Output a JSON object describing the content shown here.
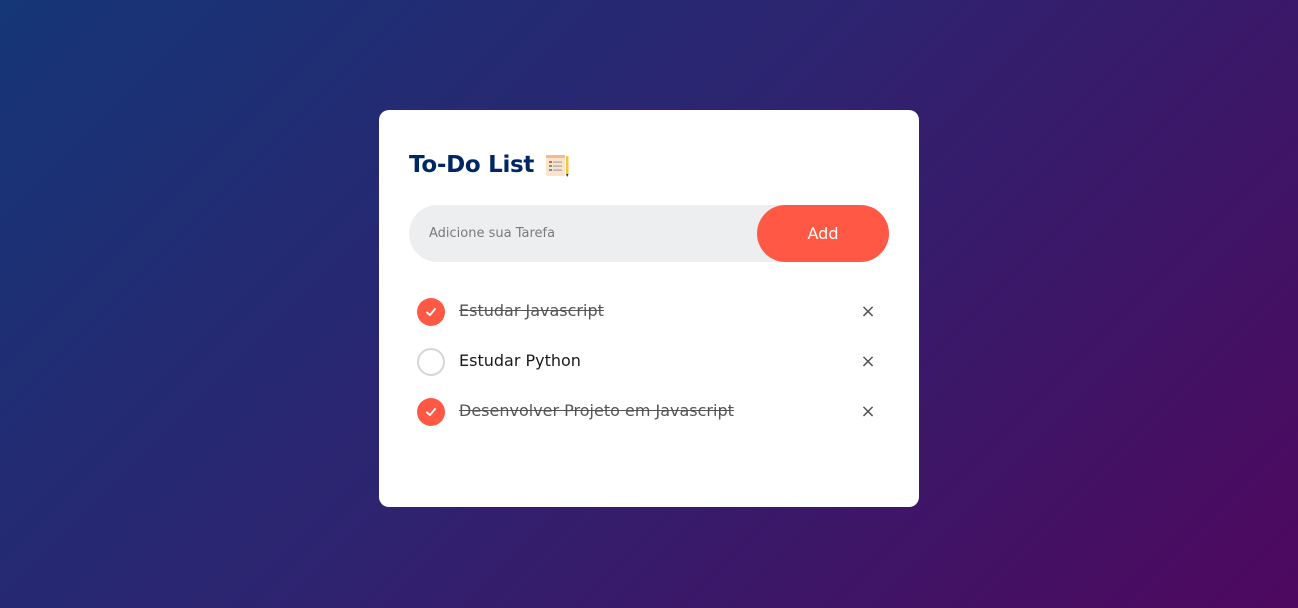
{
  "card": {
    "title": "To-Do List",
    "title_icon": "checklist-notepad-icon"
  },
  "input": {
    "placeholder": "Adicione sua Tarefa",
    "value": ""
  },
  "add_button": {
    "label": "Add"
  },
  "tasks": [
    {
      "label": "Estudar Javascript",
      "done": true
    },
    {
      "label": "Estudar Python",
      "done": false
    },
    {
      "label": "Desenvolver Projeto em Javascript",
      "done": true
    }
  ],
  "delete_glyph": "×",
  "colors": {
    "accent": "#ff5945",
    "title": "#002765",
    "input_bg": "#edeef0",
    "bg_start": "#153677",
    "bg_end": "#4e085f"
  }
}
